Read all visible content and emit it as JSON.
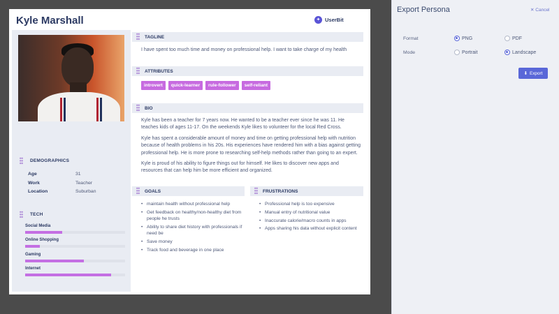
{
  "persona": {
    "name": "Kyle Marshall",
    "brand": "UserBit",
    "demographics": {
      "title": "DEMOGRAPHICS",
      "rows": [
        {
          "key": "Age",
          "value": "31"
        },
        {
          "key": "Work",
          "value": "Teacher"
        },
        {
          "key": "Location",
          "value": "Suburban"
        }
      ]
    },
    "tech": {
      "title": "TECH",
      "items": [
        {
          "label": "Social Media",
          "level": 0.37
        },
        {
          "label": "Online Shopping",
          "level": 0.15
        },
        {
          "label": "Gaming",
          "level": 0.59
        },
        {
          "label": "Internet",
          "level": 0.86
        }
      ]
    },
    "tagline": {
      "title": "TAGLINE",
      "text": "I have spent too much time and money on professional help. I want to take charge of my health"
    },
    "attributes": {
      "title": "ATTRIBUTES",
      "tags": [
        "introvert",
        "quick-learner",
        "rule-follower",
        "self-reliant"
      ]
    },
    "bio": {
      "title": "BIO",
      "paragraphs": [
        "Kyle has been a teacher for 7 years now. He wanted to be a teacher ever since he was 11. He teaches kids of ages 11-17. On the weekends Kyle likes to volunteer for the local Red Cross.",
        "Kyle has spent a considerable amount of money and time on getting professional help with nutrition because of health problems in his 20s. His experiences have rendered him with a bias against getting professional help. He is more prone to researching self-help methods rather than going to an expert.",
        "Kyle is proud of his ability to figure things out for himself. He likes to discover new apps and resources that can help him be more efficient and organized."
      ]
    },
    "goals": {
      "title": "GOALS",
      "items": [
        "maintain health without professional help",
        "Get feedback on healthy/non-healthy diet from people he trusts",
        "Ability to share diet history with professionals if need be",
        "Save money",
        "Track food and beverage in one place"
      ]
    },
    "frustrations": {
      "title": "FRUSTRATIONS",
      "items": [
        "Professional help is too expensive",
        "Manual entry of nutritional value",
        "Inaccurate calorie/macro counts in apps",
        "Apps sharing his data without explicit content"
      ]
    }
  },
  "export_panel": {
    "title": "Export Persona",
    "cancel_label": "Cancel",
    "format_label": "Format",
    "format_options": [
      "PNG",
      "PDF"
    ],
    "format_selected": "PNG",
    "mode_label": "Mode",
    "mode_options": [
      "Portrait",
      "Landscape"
    ],
    "mode_selected": "Landscape",
    "export_label": "Export"
  },
  "colors": {
    "accent": "#5967d8",
    "tag": "#c76be0",
    "bar_fill": "#c46fe3",
    "section_bg": "#e9ecf3"
  }
}
